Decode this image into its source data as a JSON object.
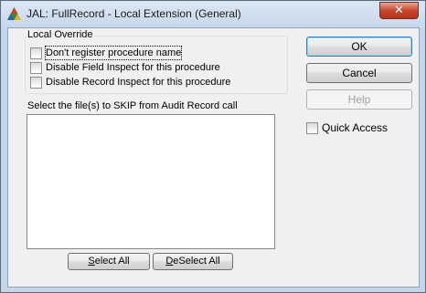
{
  "window": {
    "title": "JAL: FullRecord - Local Extension (General)",
    "close_glyph": "✕"
  },
  "local_override": {
    "label": "Local Override",
    "options": [
      {
        "label": "Don't register procedure name",
        "checked": false,
        "focused": true
      },
      {
        "label": "Disable Field Inspect for this procedure",
        "checked": false
      },
      {
        "label": "Disable Record Inspect for this procedure",
        "checked": false
      }
    ]
  },
  "files": {
    "label": "Select the file(s) to SKIP from Audit Record call",
    "items": [],
    "select_all_mnemonic": "S",
    "select_all_rest": "elect All",
    "deselect_all_mnemonic": "D",
    "deselect_all_rest": "eSelect All"
  },
  "buttons": {
    "ok": "OK",
    "cancel": "Cancel",
    "help": "Help"
  },
  "quick_access": {
    "label": "Quick Access",
    "checked": false
  },
  "colors": {
    "close_red": "#c9462c",
    "title_bg": "#c6d8ec",
    "dialog_bg": "#f0f0f0"
  }
}
